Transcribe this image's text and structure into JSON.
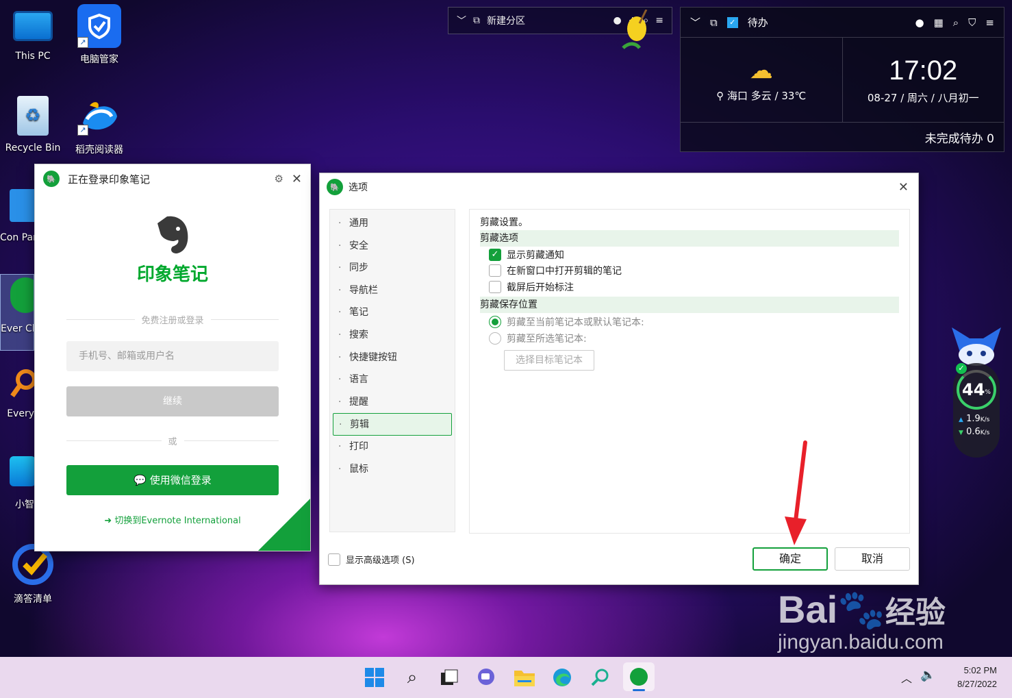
{
  "desktop": {
    "icons": [
      {
        "label": "This PC"
      },
      {
        "label": "电脑管家"
      },
      {
        "label": "Recycle Bin"
      },
      {
        "label": "稻壳阅读器"
      },
      {
        "label": "Con Par"
      },
      {
        "label": "Ever Chi"
      },
      {
        "label": "Every"
      },
      {
        "label": "小智"
      },
      {
        "label": "滴答清单"
      }
    ]
  },
  "topbar": {
    "label": "新建分区"
  },
  "todo_widget": {
    "title": "待办",
    "weather": "海口 多云 / 33℃",
    "time": "17:02",
    "date": "08-27 / 周六 / 八月初一",
    "footer": "未完成待办 0"
  },
  "login": {
    "title": "正在登录印象笔记",
    "brand": "印象笔记",
    "divider1": "免费注册或登录",
    "input_placeholder": "手机号、邮箱或用户名",
    "continue": "继续",
    "or": "或",
    "wechat": "使用微信登录",
    "switch": "切换到Evernote International"
  },
  "options": {
    "title": "选项",
    "nav": [
      "通用",
      "安全",
      "同步",
      "导航栏",
      "笔记",
      "搜索",
      "快捷键按钮",
      "语言",
      "提醒",
      "剪辑",
      "打印",
      "鼠标"
    ],
    "selected_nav": "剪辑",
    "heading": "剪藏设置。",
    "section1": "剪藏选项",
    "checks": [
      {
        "label": "显示剪藏通知",
        "checked": true
      },
      {
        "label": "在新窗口中打开剪辑的笔记",
        "checked": false
      },
      {
        "label": "截屏后开始标注",
        "checked": false
      }
    ],
    "section2": "剪藏保存位置",
    "radios": [
      {
        "label": "剪藏至当前笔记本或默认笔记本:",
        "selected": true
      },
      {
        "label": "剪藏至所选笔记本:",
        "selected": false
      }
    ],
    "pick_button": "选择目标笔记本",
    "advanced": "显示高级选项 (S)",
    "ok": "确定",
    "cancel": "取消"
  },
  "monitor": {
    "percent": "44",
    "percent_unit": "%",
    "up": "1.9",
    "down": "0.6",
    "rate_unit": "K/s"
  },
  "taskbar": {
    "time": "5:02 PM",
    "date": "8/27/2022"
  },
  "watermark": {
    "brand": "Bai",
    "brand_cn": "经验",
    "url": "jingyan.baidu.com"
  },
  "colors": {
    "accent": "#13a03b",
    "arrow": "#e8202a"
  }
}
